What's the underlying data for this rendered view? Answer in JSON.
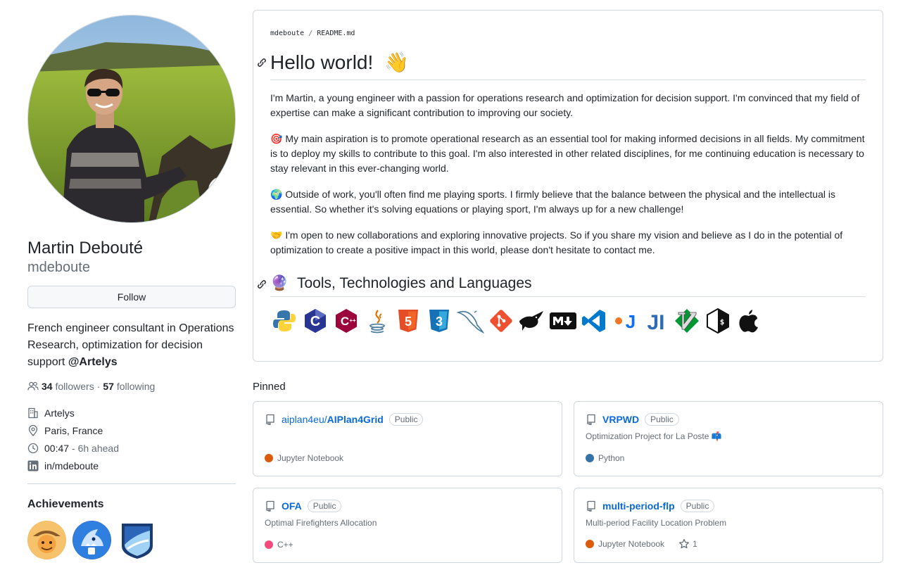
{
  "profile": {
    "full_name": "Martin Debouté",
    "username": "mdeboute",
    "status_emoji": "🌱",
    "follow_label": "Follow",
    "bio_text": "French engineer consultant in Operations Research, optimization for decision support ",
    "bio_mention": "@Artelys",
    "followers_count": "34",
    "followers_label": "followers",
    "following_count": "57",
    "following_label": "following",
    "company": "Artelys",
    "location": "Paris, France",
    "local_time": "00:47",
    "time_offset": "- 6h ahead",
    "linkedin": "in/mdeboute"
  },
  "achievements": {
    "title": "Achievements",
    "badges": [
      "pull-shark",
      "starstruck",
      "yolo"
    ]
  },
  "readme": {
    "owner": "mdeboute",
    "separator": "/",
    "file": "README.md",
    "heading": "Hello world!",
    "heading_emoji": "👋",
    "intro": "I'm Martin, a young engineer with a passion for operations research and optimization for decision support. I'm convinced that my field of expertise can make a significant contribution to improving our society.",
    "aspiration_emoji": "🎯",
    "aspiration": "My main aspiration is to promote operational research as an essential tool for making informed decisions in all fields. My commitment is to deploy my skills to contribute to this goal. I'm also interested in other related disciplines, for me continuing education is necessary to stay relevant in this ever-changing world.",
    "outside_emoji": "🌍",
    "outside": "Outside of work, you'll often find me playing sports. I firmly believe that the balance between the physical and the intellectual is essential. So whether it's solving equations or playing sport, I'm always up for a new challenge!",
    "collab_emoji": "🤝",
    "collab": "I'm open to new collaborations and exploring innovative projects. So if you share my vision and believe as I do in the potential of optimization to create a positive impact in this world, please don't hesitate to contact me.",
    "tools_emoji": "🔮",
    "tools_heading": "Tools, Technologies and Languages",
    "tools": [
      "python-icon",
      "c-icon",
      "cplusplus-icon",
      "java-icon",
      "html5-icon",
      "css3-icon",
      "mysql-icon",
      "git-icon",
      "bash-bird-icon",
      "markdown-icon",
      "vscode-icon",
      "jupyter-icon",
      "julia-icon",
      "vim-icon",
      "shell-icon",
      "apple-icon"
    ]
  },
  "pinned": {
    "title": "Pinned",
    "repos": [
      {
        "owner": "aiplan4eu/",
        "name": "AIPlan4Grid",
        "visibility": "Public",
        "description": "",
        "language": "Jupyter Notebook",
        "lang_color": "#DA5B0B",
        "stars": ""
      },
      {
        "owner": "",
        "name": "VRPWD",
        "visibility": "Public",
        "description": "Optimization Project for La Poste 📫",
        "language": "Python",
        "lang_color": "#3572A5",
        "stars": ""
      },
      {
        "owner": "",
        "name": "OFA",
        "visibility": "Public",
        "description": "Optimal Firefighters Allocation",
        "language": "C++",
        "lang_color": "#f34b7d",
        "stars": ""
      },
      {
        "owner": "",
        "name": "multi-period-flp",
        "visibility": "Public",
        "description": "Multi-period Facility Location Problem",
        "language": "Jupyter Notebook",
        "lang_color": "#DA5B0B",
        "stars": "1"
      }
    ]
  },
  "colors": {
    "accent": "#0969da",
    "border": "#d0d7de",
    "muted": "#656d76",
    "text": "#1f2328"
  }
}
